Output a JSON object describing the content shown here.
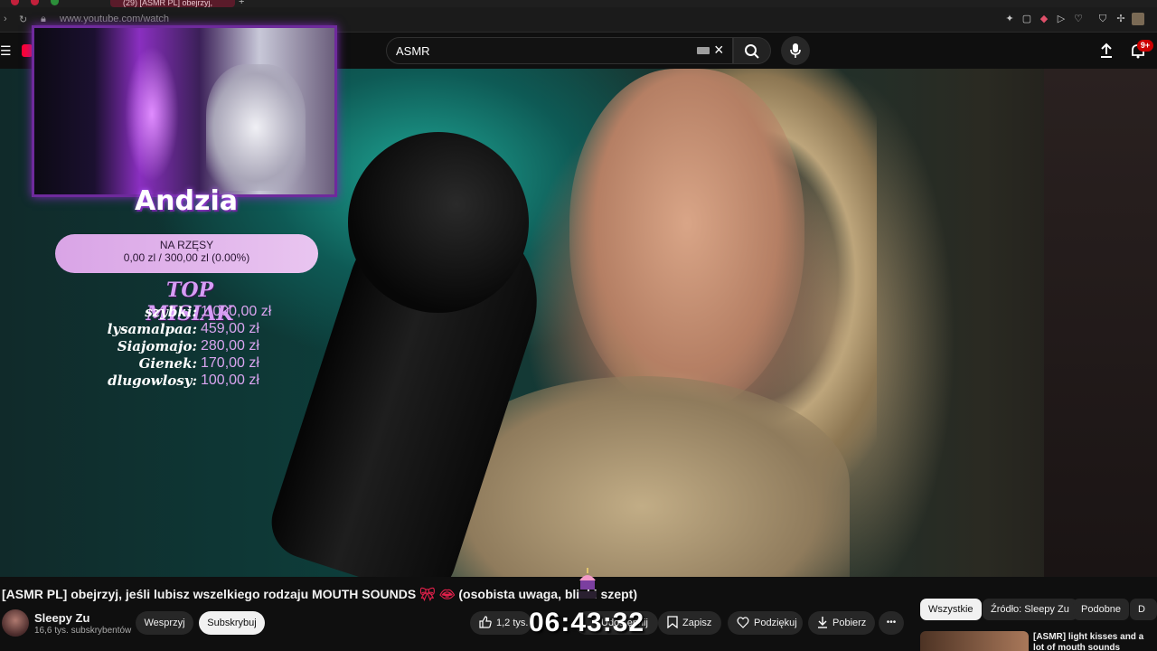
{
  "browser": {
    "tab_title": "(29) [ASMR PL] obejrzyj,",
    "url": "www.youtube.com/watch"
  },
  "masthead": {
    "search_value": "ASMR",
    "notification_count": "9+"
  },
  "overlay": {
    "streamer_name": "Andzia",
    "goal_title": "NA RZĘSY",
    "goal_amount": "0,00 zl / 300,00 zl (0.00%)",
    "top_title": "TOP MISIAK",
    "top_donors": [
      {
        "name": "szybki:",
        "amount": "1 000,00 zł"
      },
      {
        "name": "lysamalpaa:",
        "amount": "459,00 zł"
      },
      {
        "name": "Siajomajo:",
        "amount": "280,00 zł"
      },
      {
        "name": "Gienek:",
        "amount": "170,00 zł"
      },
      {
        "name": "dlugowlosy:",
        "amount": "100,00 zł"
      }
    ]
  },
  "video": {
    "title": "[ASMR PL] obejrzyj, jeśli lubisz wszelkiego rodzaju MOUTH SOUNDS",
    "title_tail": "(osobista uwaga, bliski szept)",
    "channel_name": "Sleepy Zu",
    "subscribers": "16,6 tys. subskrybentów",
    "support_label": "Wesprzyj",
    "subscribe_label": "Subskrybuj",
    "likes": "1,2 tys.",
    "share_label": "Udostępnij",
    "save_label": "Zapisz",
    "thanks_label": "Podziękuj",
    "download_label": "Pobierz",
    "more_label": "•••",
    "clock_overlay": "06:43:32"
  },
  "recommendations": {
    "chips": [
      "Wszystkie",
      "Źródło: Sleepy Zu",
      "Podobne",
      "D"
    ],
    "first_title": "[ASMR] light kisses and a lot of mouth sounds"
  },
  "colors": {
    "accent_red": "#ff0033",
    "overlay_purple": "#6e2a9c",
    "goal_pink": "#d9a4e6"
  }
}
